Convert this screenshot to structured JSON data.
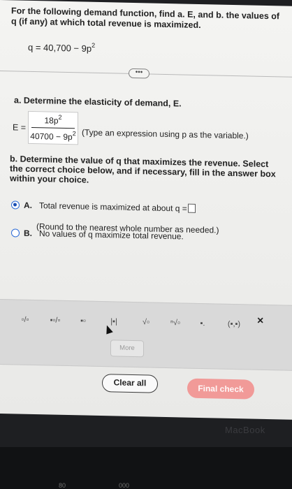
{
  "prompt": {
    "part1": "For the following demand function, find ",
    "a_bold": "a.",
    "part2": " E, and ",
    "b_bold": "b.",
    "part3": " the values of q (if any) at which total revenue is maximized."
  },
  "demand_equation": {
    "lhs": "q = 40,700 − 9p",
    "exp": "2"
  },
  "more_dots": "•••",
  "part_a": {
    "question": "a. Determine the elasticity of demand, E.",
    "e_label": "E =",
    "numerator": "18p",
    "numerator_exp": "2",
    "denominator": "40700 − 9p",
    "denominator_exp": "2",
    "hint": "(Type an expression using p as the variable.)"
  },
  "part_b": {
    "question": "b. Determine the value of q that maximizes the revenue. Select the correct choice below, and if necessary, fill in the answer box within your choice.",
    "option_a_letter": "A.",
    "option_a_text": "Total revenue is maximized at about q =",
    "option_a_sub": "(Round to the nearest whole number as needed.)",
    "option_b_letter": "B.",
    "option_b_text": "No values of q maximize total revenue."
  },
  "toolbar": {
    "btn_fraction": "▫/▫",
    "btn_mixed": "▪▫/▫",
    "btn_power": "▪▫",
    "btn_abs": "|▪|",
    "btn_sqrt": "√▫",
    "btn_nroot": "ⁿ√▫",
    "btn_decimal": "▪.",
    "btn_point": "(▪,▪)",
    "close": "×",
    "more": "More"
  },
  "buttons": {
    "clear_all": "Clear all",
    "final_check": "Final check"
  },
  "bezel": {
    "brand": "MacBook"
  },
  "keys": {
    "f3": "80",
    "f4": "000"
  },
  "colors": {
    "radio_accent": "#1c4fb3",
    "final_check_bg": "#f19a98"
  }
}
